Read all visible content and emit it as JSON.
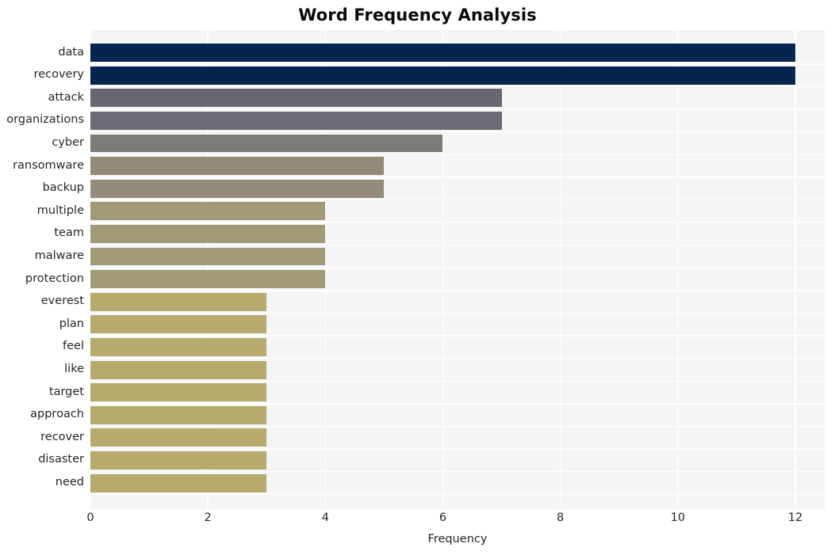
{
  "chart_data": {
    "type": "bar",
    "orientation": "horizontal",
    "title": "Word Frequency Analysis",
    "xlabel": "Frequency",
    "ylabel": "",
    "categories": [
      "data",
      "recovery",
      "attack",
      "organizations",
      "cyber",
      "ransomware",
      "backup",
      "multiple",
      "team",
      "malware",
      "protection",
      "everest",
      "plan",
      "feel",
      "like",
      "target",
      "approach",
      "recover",
      "disaster",
      "need"
    ],
    "values": [
      12,
      12,
      7,
      7,
      6,
      5,
      5,
      4,
      4,
      4,
      4,
      3,
      3,
      3,
      3,
      3,
      3,
      3,
      3,
      3
    ],
    "bar_colors": [
      "#04254e",
      "#04254e",
      "#67676f",
      "#6a6a72",
      "#7c7b78",
      "#928b79",
      "#938c7c",
      "#a09a77",
      "#a09a77",
      "#a09a77",
      "#a09a77",
      "#b6ab6d",
      "#b6ab6d",
      "#b6ab6d",
      "#b6ab6d",
      "#b6ab6d",
      "#b6ab6d",
      "#b6ab6d",
      "#b6ab6d",
      "#b6ab6d"
    ],
    "xticks": [
      0,
      2,
      4,
      6,
      8,
      10,
      12
    ],
    "xtick_labels": [
      "0",
      "2",
      "4",
      "6",
      "8",
      "10",
      "12"
    ],
    "xlim": [
      0,
      12.5
    ],
    "grid": true,
    "grid_color": "#ffffff",
    "plot_background": "#f5f5f5",
    "figure_background": "#ffffff",
    "legend": null
  }
}
